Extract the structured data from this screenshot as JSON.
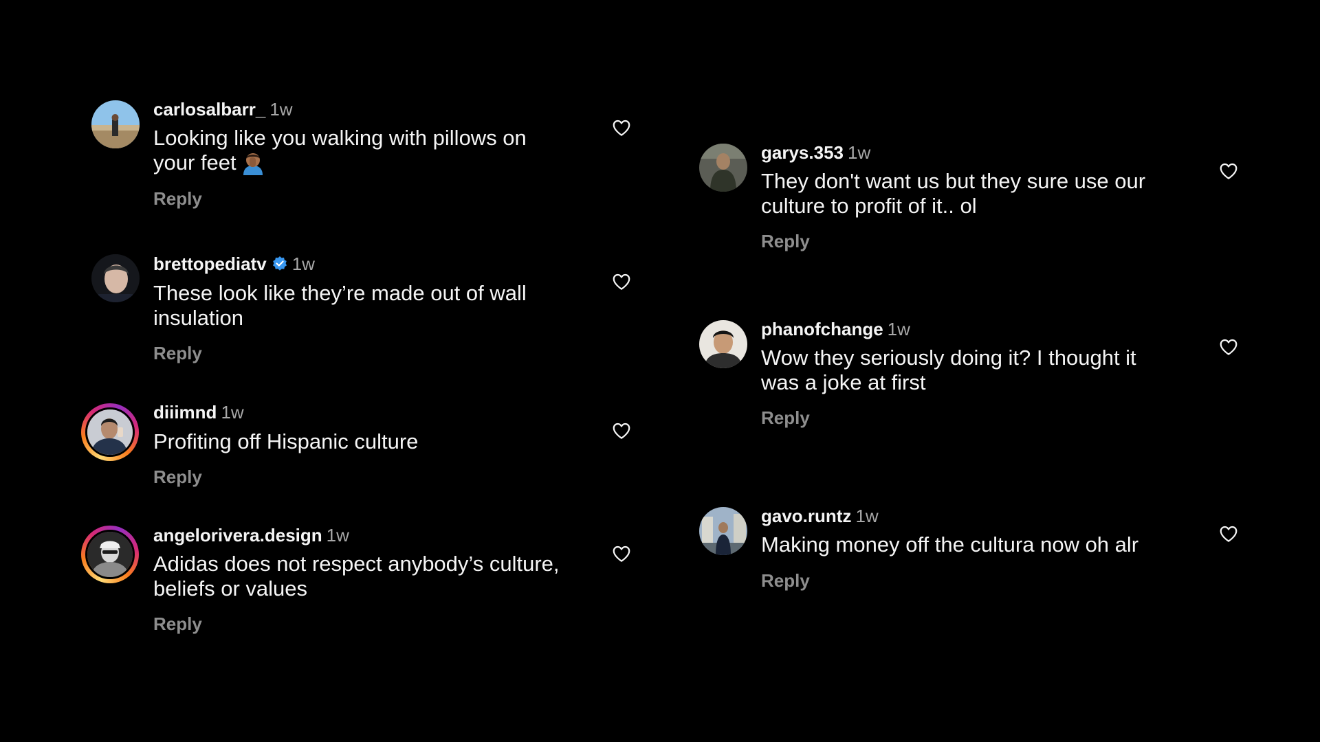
{
  "comments_left": [
    {
      "username": "carlosalbarr_",
      "time": "1w",
      "text": "Looking like you walking with pillows on your feet",
      "emoji": "person-facepalming-emoji",
      "reply": "Reply",
      "verified": false
    },
    {
      "username": "brettopediatv",
      "time": "1w",
      "text": "These look like they’re made out of wall insulation",
      "reply": "Reply",
      "verified": true
    },
    {
      "username": "diiimnd",
      "time": "1w",
      "text": "Profiting off Hispanic culture",
      "reply": "Reply",
      "verified": false
    },
    {
      "username": "angelorivera.design",
      "time": "1w",
      "text": "Adidas does not respect anybody’s culture, beliefs or values",
      "reply": "Reply",
      "verified": false
    }
  ],
  "comments_right": [
    {
      "username": "garys.353",
      "time": "1w",
      "text": "They don't want us but they sure use our culture to profit of it.. ol",
      "reply": "Reply",
      "verified": false
    },
    {
      "username": "phanofchange",
      "time": "1w",
      "text": "Wow they seriously doing it? I thought it was a joke at first",
      "reply": "Reply",
      "verified": false
    },
    {
      "username": "gavo.runtz",
      "time": "1w",
      "text": "Making money off the cultura now oh alr",
      "reply": "Reply",
      "verified": false
    }
  ],
  "icons": {
    "like": "heart-outline-icon",
    "verified": "verified-badge-icon"
  },
  "colors": {
    "background": "#000000",
    "text": "#f5f5f5",
    "muted": "#a8a8a8",
    "reply": "#8e8e8e",
    "verified": "#3897f0"
  }
}
